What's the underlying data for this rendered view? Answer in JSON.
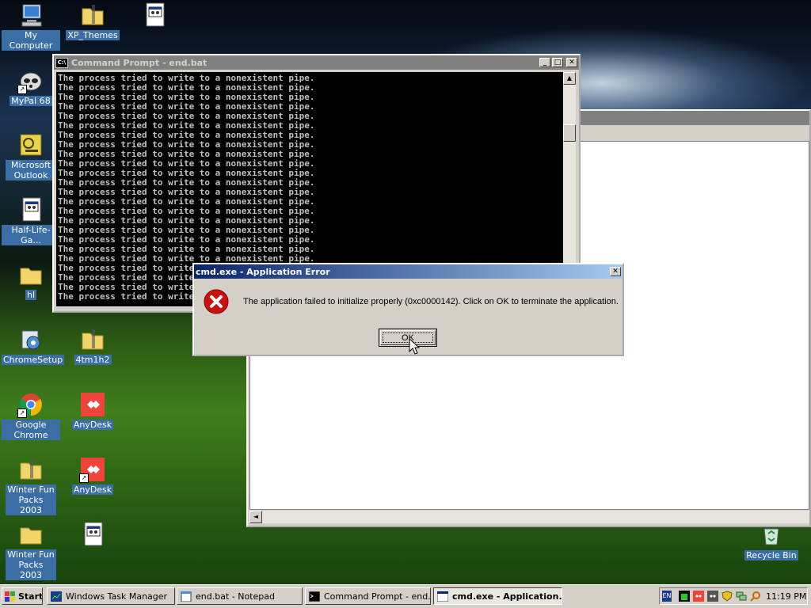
{
  "desktop": {
    "icons": {
      "my_computer": "My Computer",
      "xp_themes": "XP_Themes",
      "mypal": "MyPal 68",
      "outlook": "Microsoft Outlook",
      "halflife": "Half-Life-Ga...",
      "hl": "hl",
      "chrome_setup": "ChromeSetup",
      "tm": "4tm1h2",
      "google_chrome": "Google Chrome",
      "anydesk1": "AnyDesk",
      "anydesk2": "AnyDesk",
      "winter_packs_zip": "Winter Fun Packs 2003",
      "winter_packs_folder": "Winter Fun Packs 2003",
      "recycle_bin": "Recycle Bin"
    }
  },
  "cmd_window": {
    "title": "Command Prompt - end.bat",
    "line_text": "The process tried to write to a nonexistent pipe.",
    "line_count": 24
  },
  "error_dialog": {
    "title": "cmd.exe - Application Error",
    "message": "The application failed to initialize properly (0xc0000142). Click on OK to terminate the application.",
    "ok_label": "OK"
  },
  "taskbar": {
    "start_label": "Start",
    "tasks": [
      {
        "label": "Windows Task Manager"
      },
      {
        "label": "end.bat - Notepad"
      },
      {
        "label": "Command Prompt - end.bat"
      },
      {
        "label": "cmd.exe - Application..."
      }
    ],
    "language": "EN",
    "clock": "11:19 PM"
  },
  "colors": {
    "title_active": "#0a246a",
    "title_inactive": "#808080",
    "error_red": "#cc1010",
    "selection_blue": "#3a6ea5"
  }
}
